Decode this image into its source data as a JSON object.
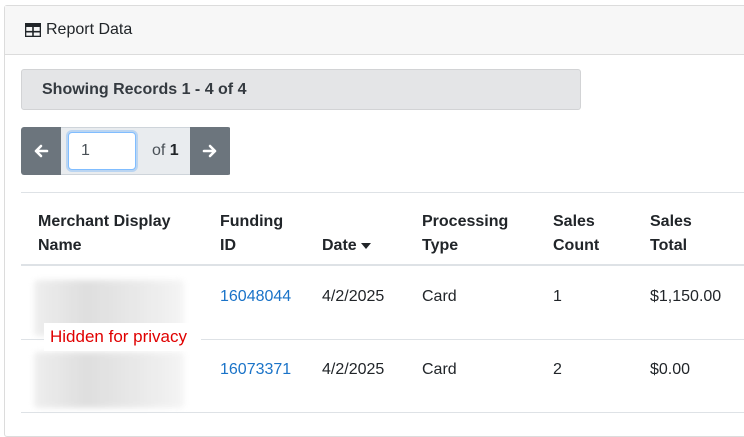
{
  "panel": {
    "title": "Report Data",
    "icon": "table-icon"
  },
  "records": {
    "text": "Showing Records 1 - 4 of 4"
  },
  "pager": {
    "current_page": "1",
    "of_label": "of",
    "total_pages": "1",
    "prev_icon": "arrow-left-icon",
    "next_icon": "arrow-right-icon"
  },
  "table": {
    "headers": {
      "merchant_line1": "Merchant Display",
      "merchant_line2": "Name",
      "funding_line1": "Funding",
      "funding_line2": "ID",
      "date": "Date",
      "processing_line1": "Processing",
      "processing_line2": "Type",
      "count_line1": "Sales",
      "count_line2": "Count",
      "total_line1": "Sales",
      "total_line2": "Total"
    },
    "rows": [
      {
        "funding_id": "16048044",
        "date": "4/2/2025",
        "type": "Card",
        "count": "1",
        "total": "$1,150.00"
      },
      {
        "funding_id": "16073371",
        "date": "4/2/2025",
        "type": "Card",
        "count": "2",
        "total": "$0.00"
      }
    ]
  },
  "privacy_note": "Hidden for privacy",
  "colors": {
    "link": "#1a73c8",
    "pager_button": "#6c757d",
    "privacy_text": "#e00000"
  }
}
